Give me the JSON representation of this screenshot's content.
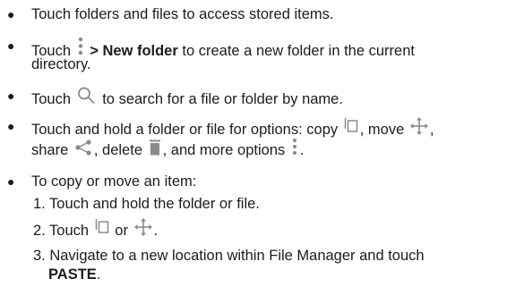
{
  "bullets": [
    {
      "text": "Touch folders and files to access stored items."
    },
    {
      "prefix": "Touch",
      "bold": "> New folder",
      "line1_rest": "to create a new folder in the current",
      "line2": "directory."
    },
    {
      "prefix": "Touch",
      "rest": "to search for a file or folder by name."
    },
    {
      "line1_prefix": "Touch and hold a folder or file for options: copy",
      "line1_mid": ", move",
      "line1_end": ",",
      "line2_a": "share",
      "line2_b": ", delete",
      "line2_c": ", and more options",
      "line2_end": "."
    },
    {
      "text": "To copy or move an item:"
    }
  ],
  "steps": [
    {
      "text": "1. Touch and hold the folder or file."
    },
    {
      "prefix": "2. Touch",
      "mid": "or",
      "end": "."
    },
    {
      "line1": "3. Navigate to a new location within File Manager and touch",
      "line2_bold": "PASTE",
      "line2_end": "."
    }
  ],
  "icons": [
    "more-vert-icon",
    "search-icon",
    "copy-icon",
    "move-icon",
    "share-icon",
    "delete-icon"
  ],
  "icon_color": "#8a8a8a"
}
